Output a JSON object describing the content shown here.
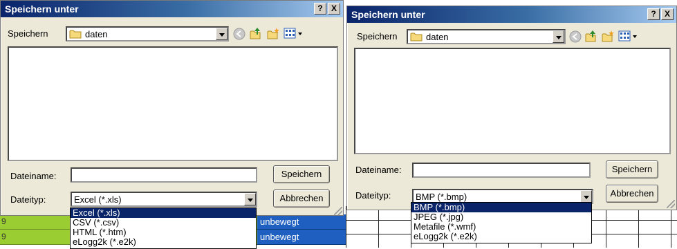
{
  "left_dialog": {
    "title": "Speichern unter",
    "help_button": "?",
    "close_button": "X",
    "save_in_label": "Speichern",
    "folder_name": "daten",
    "filename_label": "Dateiname:",
    "filename_value": "",
    "filetype_label": "Dateityp:",
    "filetype_selected": "Excel (*.xls)",
    "save_button": "Speichern",
    "cancel_button": "Abbrechen",
    "filetype_options": [
      "Excel (*.xls)",
      "CSV (*.csv)",
      "HTML (*.htm)",
      "eLogg2k (*.e2k)"
    ]
  },
  "right_dialog": {
    "title": "Speichern unter",
    "help_button": "?",
    "close_button": "X",
    "save_in_label": "Speichern",
    "folder_name": "daten",
    "filename_label": "Dateiname:",
    "filename_value": "",
    "filetype_label": "Dateityp:",
    "filetype_selected": "BMP (*.bmp)",
    "save_button": "Speichern",
    "cancel_button": "Abbrechen",
    "filetype_options": [
      "BMP (*.bmp)",
      "JPEG (*.jpg)",
      "Metafile (*.wmf)",
      "eLogg2k (*.e2k)"
    ]
  },
  "background_sheet": {
    "rows": [
      {
        "first_cell": "9",
        "status": "unbewegt"
      },
      {
        "first_cell": "9",
        "status": "unbewegt"
      }
    ]
  },
  "colors": {
    "selection": "#0a246a",
    "row_green": "#9acd32",
    "row_blue": "#1f5fbf"
  }
}
